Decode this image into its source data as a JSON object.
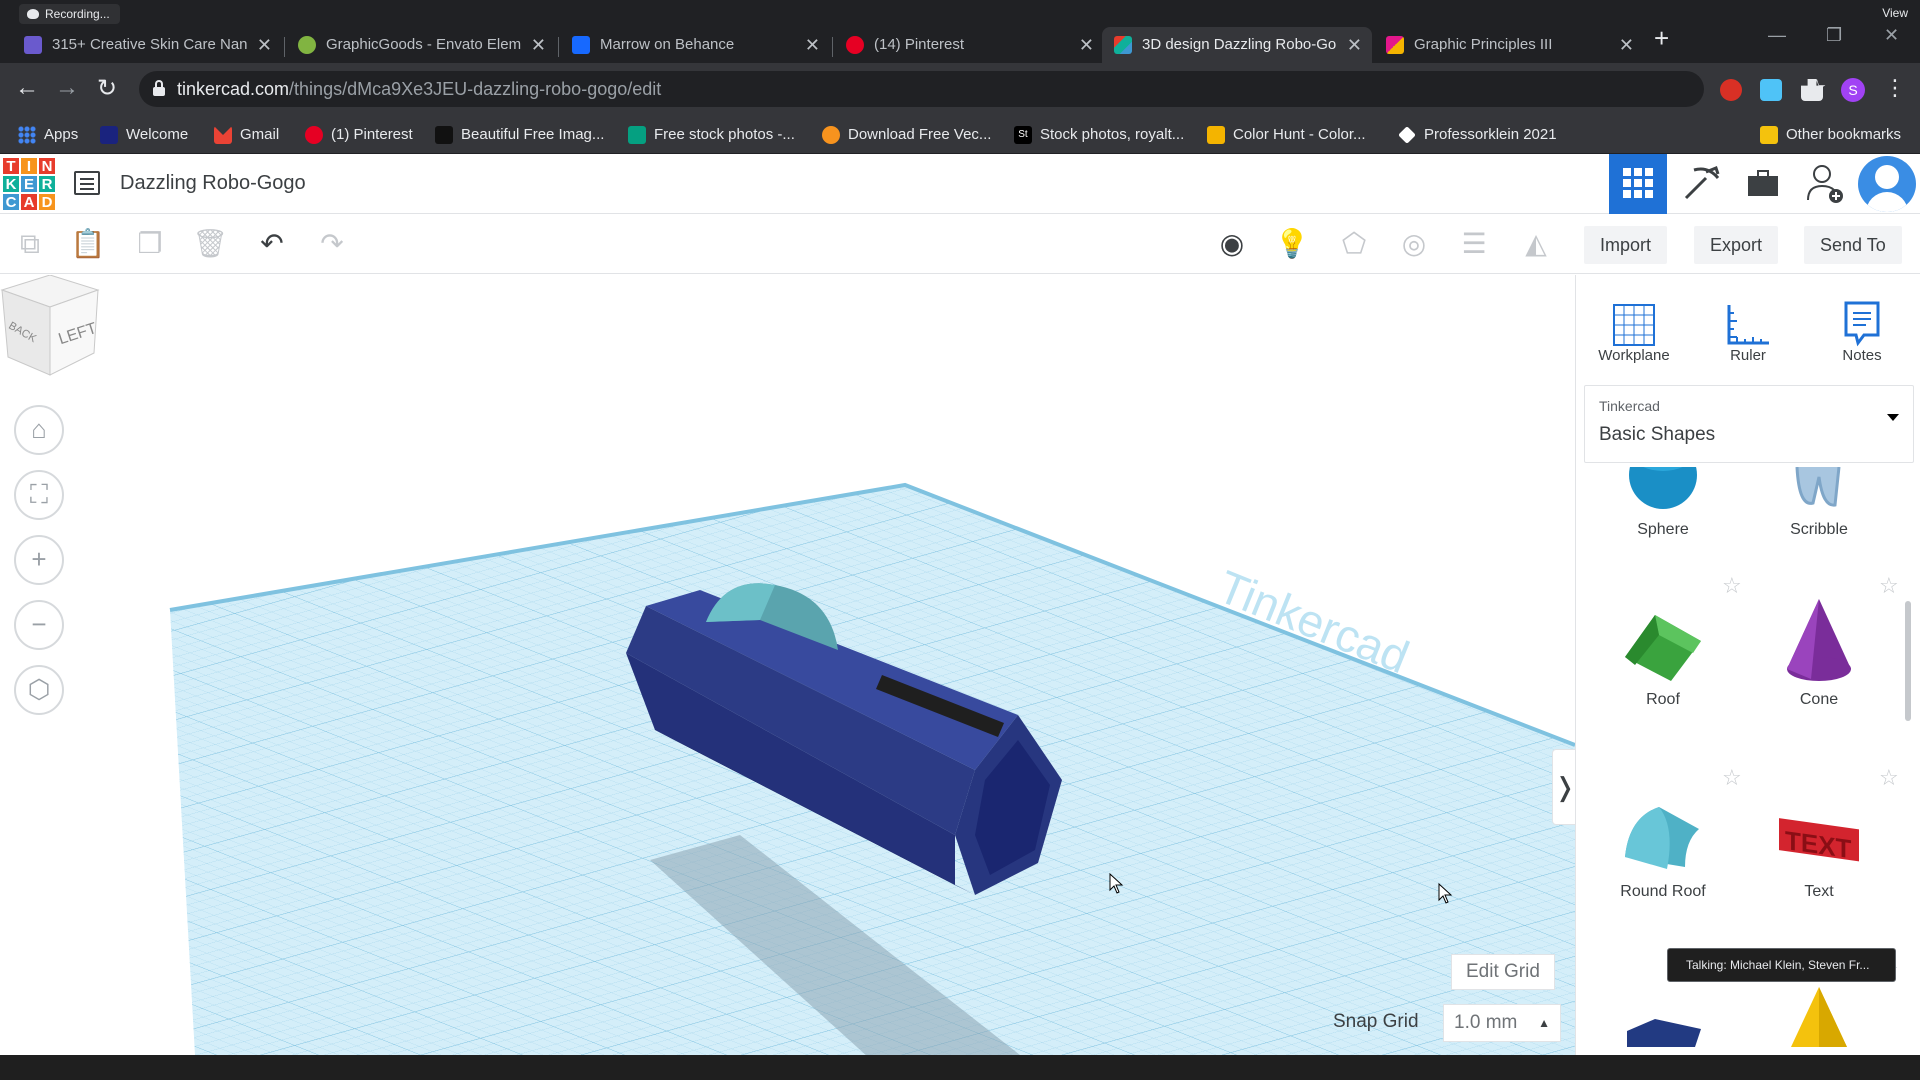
{
  "recording": {
    "label": "Recording..."
  },
  "view_label": "View",
  "browser": {
    "tabs": [
      {
        "title": "315+ Creative Skin Care Nan",
        "color": "#6a5acd"
      },
      {
        "title": "GraphicGoods - Envato Elem",
        "color": "#81b441"
      },
      {
        "title": "Marrow on Behance",
        "color": "#1769ff"
      },
      {
        "title": "(14) Pinterest",
        "color": "#e60023"
      },
      {
        "title": "3D design Dazzling Robo-Go",
        "color": "#ee3b23",
        "active": true
      },
      {
        "title": "Graphic Principles III",
        "color": "#e3178b"
      }
    ],
    "url_host": "tinkercad.com",
    "url_path": "/things/dMca9Xe3JEU-dazzling-robo-gogo/edit",
    "profile_initial": "S",
    "bookmarks": [
      {
        "label": "Apps",
        "color": "#4285f4"
      },
      {
        "label": "Welcome",
        "color": "#1a237e"
      },
      {
        "label": "Gmail",
        "color": "#ea4335"
      },
      {
        "label": "(1) Pinterest",
        "color": "#e60023"
      },
      {
        "label": "Beautiful Free Imag...",
        "color": "#111111"
      },
      {
        "label": "Free stock photos -...",
        "color": "#05a081"
      },
      {
        "label": "Download Free Vec...",
        "color": "#f7931e"
      },
      {
        "label": "Stock photos, royalt...",
        "color": "#000000"
      },
      {
        "label": "Color Hunt - Color...",
        "color": "#f4b400"
      },
      {
        "label": "Professorklein 2021",
        "color": "#ffffff"
      }
    ],
    "other_bookmarks": "Other bookmarks"
  },
  "tinkercad": {
    "logo_letters": [
      "T",
      "I",
      "N",
      "K",
      "E",
      "R",
      "C",
      "A",
      "D"
    ],
    "logo_colors": [
      "#e73c2c",
      "#f7941d",
      "#e73c2c",
      "#0fb09a",
      "#3e98d2",
      "#0fb09a",
      "#3e98d2",
      "#e73c2c",
      "#f7941d"
    ],
    "design_title": "Dazzling Robo-Gogo",
    "actions": {
      "import": "Import",
      "export": "Export",
      "send_to": "Send To"
    },
    "viewcube": {
      "front": "LEFT",
      "side": "BACK"
    },
    "workplane_text": "Tinkercad",
    "edit_grid": "Edit Grid",
    "snap_grid": {
      "label": "Snap Grid",
      "value": "1.0 mm"
    },
    "panel": {
      "tools": [
        {
          "label": "Workplane",
          "icon": "workplane-icon"
        },
        {
          "label": "Ruler",
          "icon": "ruler-icon"
        },
        {
          "label": "Notes",
          "icon": "notes-icon"
        }
      ],
      "library_source": "Tinkercad",
      "library_name": "Basic Shapes",
      "shapes": [
        "Sphere",
        "Scribble",
        "Roof",
        "Cone",
        "Round Roof",
        "Text"
      ]
    },
    "toast": "Talking: Michael Klein, Steven Fr...",
    "colors": {
      "accent": "#1f71d6",
      "grid": "#bde3f3",
      "object": "#2f3f8f"
    }
  }
}
